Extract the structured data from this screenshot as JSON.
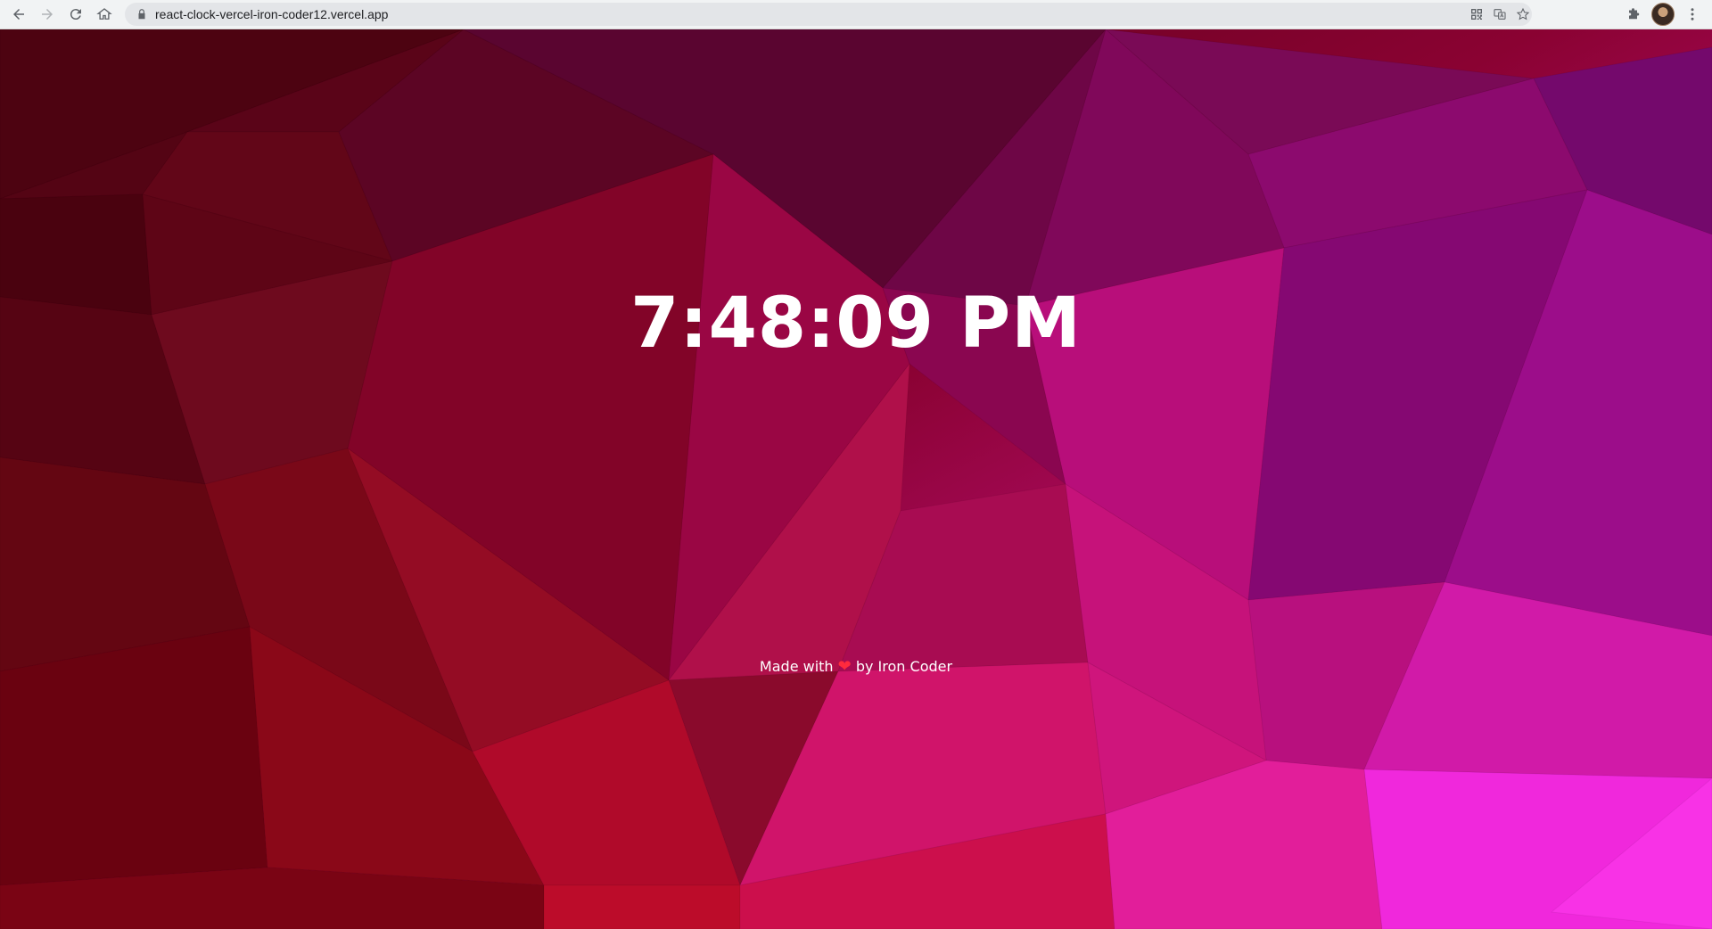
{
  "browser": {
    "url": "react-clock-vercel-iron-coder12.vercel.app",
    "icons": [
      "back-arrow-icon",
      "forward-arrow-icon",
      "reload-icon",
      "home-icon",
      "lock-icon",
      "qr-code-icon",
      "translate-icon",
      "star-icon",
      "extensions-puzzle-icon",
      "profile-avatar",
      "kebab-menu-icon"
    ]
  },
  "clock": {
    "time": "7:48:09 PM"
  },
  "credit": {
    "prefix": "Made with",
    "heart": "❤",
    "suffix": "by Iron Coder"
  },
  "colors": {
    "text": "#ffffff",
    "heart": "#ff2a3d",
    "bg_dark_red": "#6a0010",
    "bg_crimson": "#b00a2a",
    "bg_magenta": "#d0128a",
    "bg_purple": "#7a0a7a",
    "bg_pink": "#f028e0"
  }
}
